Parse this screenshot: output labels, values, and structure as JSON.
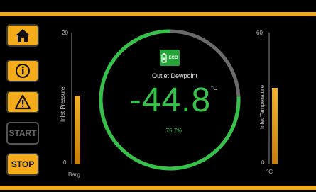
{
  "buttons": {
    "home": {
      "label": "",
      "icon": "home-icon"
    },
    "info": {
      "label": "",
      "icon": "info-icon"
    },
    "alarm": {
      "label": "",
      "icon": "warning-icon"
    },
    "start": {
      "label": "START",
      "enabled": false
    },
    "stop": {
      "label": "STOP",
      "enabled": true
    }
  },
  "pressure_gauge": {
    "label": "Inlet Pressure",
    "max": "20",
    "min": "0",
    "unit": "Barg",
    "level_fraction": 0.52
  },
  "temperature_gauge": {
    "label": "Inlet Temperature",
    "max": "60",
    "min": "0",
    "unit": "°C",
    "level_fraction": 0.58
  },
  "dewpoint": {
    "label": "Outlet Dewpoint",
    "value": "-44.8",
    "unit": "°C",
    "percent": "75.7%",
    "ring_fraction": 0.757,
    "eco_badge": "ECO"
  },
  "colors": {
    "accent": "#f5ac1a",
    "ok_green": "#36c24a",
    "ring_rest": "#6b6b6b"
  }
}
